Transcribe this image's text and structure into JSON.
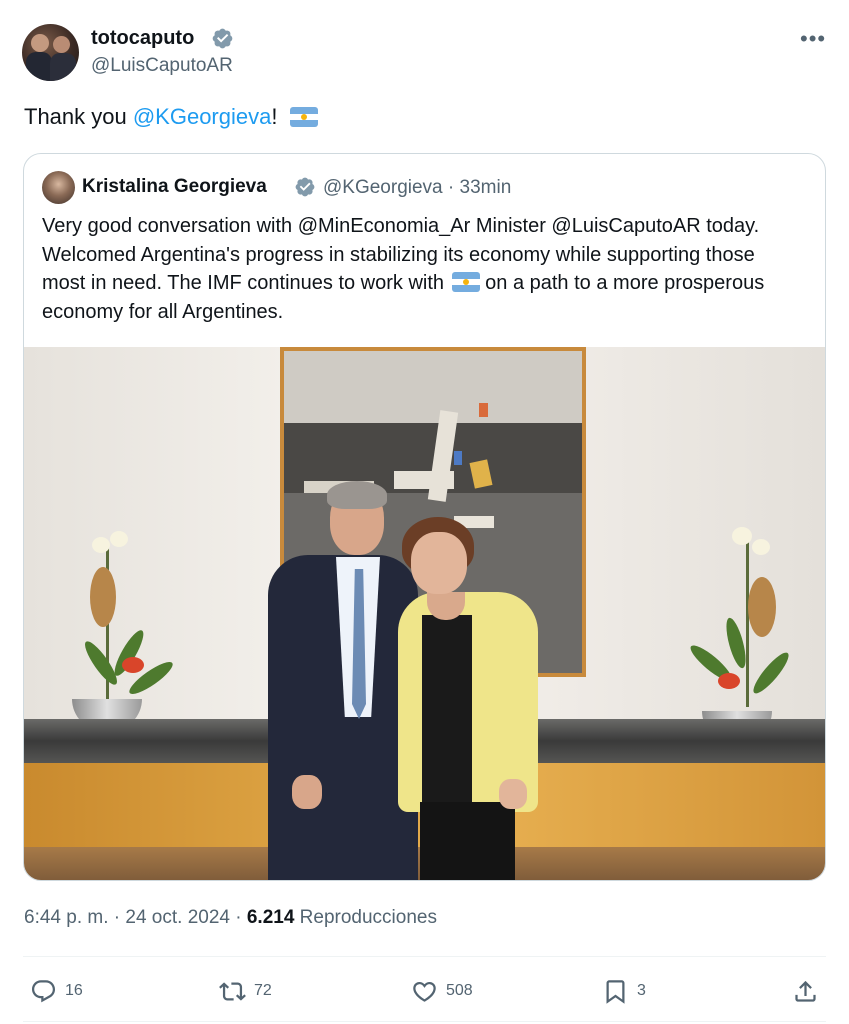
{
  "author": {
    "display_name": "totocaputo",
    "handle": "@LuisCaputoAR",
    "verified": true,
    "avatar": "avatar"
  },
  "more_icon": "more-horizontal-icon",
  "tweet": {
    "text_prefix": "Thank you ",
    "mention": "@KGeorgieva",
    "text_suffix": "!",
    "emoji": "flag-argentina"
  },
  "quote": {
    "display_name": "Kristalina Georgieva",
    "handle_time": "@KGeorgieva · 33min",
    "verified": true,
    "text_part1": "Very good conversation with @MinEconomia_Ar Minister @LuisCaputoAR today. Welcomed Argentina's progress in stabilizing its economy while supporting those most in need. The IMF continues to work with",
    "emoji": "flag-argentina",
    "text_part2": " on a path to a more prosperous economy for all Argentines."
  },
  "meta": {
    "time_date": "6:44 p. m. · 24 oct. 2024 · ",
    "views_count": "6.214",
    "views_label": " Reproducciones"
  },
  "actions": {
    "replies": "16",
    "reposts": "72",
    "likes": "508",
    "bookmarks": "3"
  },
  "colors": {
    "link": "#1d9bf0",
    "verified": "#829aab",
    "text_secondary": "#536471",
    "border": "#cfd9de"
  }
}
